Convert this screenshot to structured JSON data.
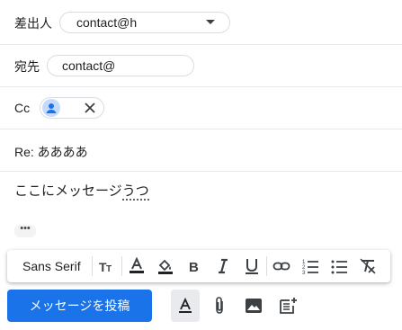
{
  "from": {
    "label": "差出人",
    "value": "contact@h"
  },
  "to": {
    "label": "宛先",
    "value": "contact@"
  },
  "cc": {
    "label": "Cc"
  },
  "subject": "Re: ああああ",
  "body": {
    "text_before": "ここにメッセージ",
    "misspelled": "うつ"
  },
  "ellipsis": "•••",
  "toolbar": {
    "font": "Sans Serif"
  },
  "send_button": "メッセージを投稿",
  "colors": {
    "primary": "#1a73e8",
    "icon": "#3c4043",
    "divider": "#e8eaed"
  },
  "icons": [
    "dropdown-arrow-icon",
    "avatar-icon",
    "close-icon",
    "font-size-icon",
    "text-color-icon",
    "highlight-color-icon",
    "bold-icon",
    "italic-icon",
    "underline-icon",
    "link-icon",
    "numbered-list-icon",
    "bulleted-list-icon",
    "remove-formatting-icon",
    "formatting-options-icon",
    "attach-icon",
    "image-icon",
    "add-note-icon"
  ]
}
